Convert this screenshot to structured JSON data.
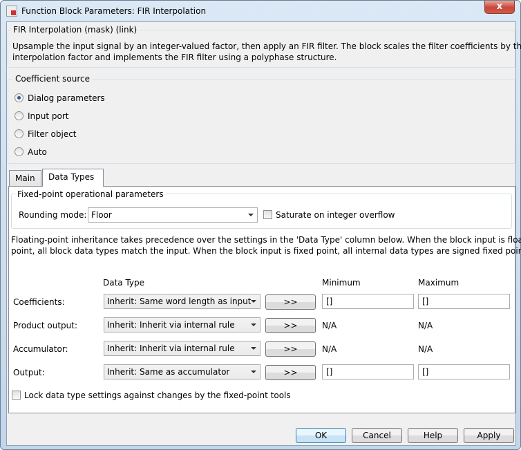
{
  "window": {
    "title": "Function Block Parameters: FIR Interpolation",
    "close_label": "x"
  },
  "mask": {
    "title": "FIR Interpolation (mask) (link)",
    "description_lines": [
      "Upsample the input signal by an integer-valued factor, then apply an FIR filter. The block scales the filter coefficients by the",
      "interpolation factor and implements the FIR filter using a polyphase structure."
    ]
  },
  "coefficient_source": {
    "title": "Coefficient source",
    "options": [
      {
        "label": "Dialog parameters",
        "selected": true
      },
      {
        "label": "Input port",
        "selected": false
      },
      {
        "label": "Filter object",
        "selected": false
      },
      {
        "label": "Auto",
        "selected": false
      }
    ]
  },
  "tabs": [
    {
      "label": "Main",
      "selected": false
    },
    {
      "label": "Data Types",
      "selected": true
    }
  ],
  "fixed_point": {
    "title": "Fixed-point operational parameters",
    "rounding_label": "Rounding mode:",
    "rounding_value": "Floor",
    "saturate_label": "Saturate on integer overflow",
    "saturate_checked": false
  },
  "info_lines": [
    "Floating-point inheritance takes precedence over the settings in the 'Data Type' column below. When the block input is floating",
    "point, all block data types match the input. When the block input is fixed point, all internal data types are signed fixed point."
  ],
  "table": {
    "headers": {
      "data_type": "Data Type",
      "minimum": "Minimum",
      "maximum": "Maximum"
    },
    "rows": [
      {
        "label": "Coefficients:",
        "data_type": "Inherit: Same word length as input",
        "button": ">>",
        "minimum": "[]",
        "maximum": "[]",
        "editable": true
      },
      {
        "label": "Product output:",
        "data_type": "Inherit: Inherit via internal rule",
        "button": ">>",
        "minimum": "N/A",
        "maximum": "N/A",
        "editable": false
      },
      {
        "label": "Accumulator:",
        "data_type": "Inherit: Inherit via internal rule",
        "button": ">>",
        "minimum": "N/A",
        "maximum": "N/A",
        "editable": false
      },
      {
        "label": "Output:",
        "data_type": "Inherit: Same as accumulator",
        "button": ">>",
        "minimum": "[]",
        "maximum": "[]",
        "editable": true
      }
    ]
  },
  "lock_label": "Lock data type settings against changes by the fixed-point tools",
  "buttons": {
    "ok": "OK",
    "cancel": "Cancel",
    "help": "Help",
    "apply": "Apply"
  }
}
